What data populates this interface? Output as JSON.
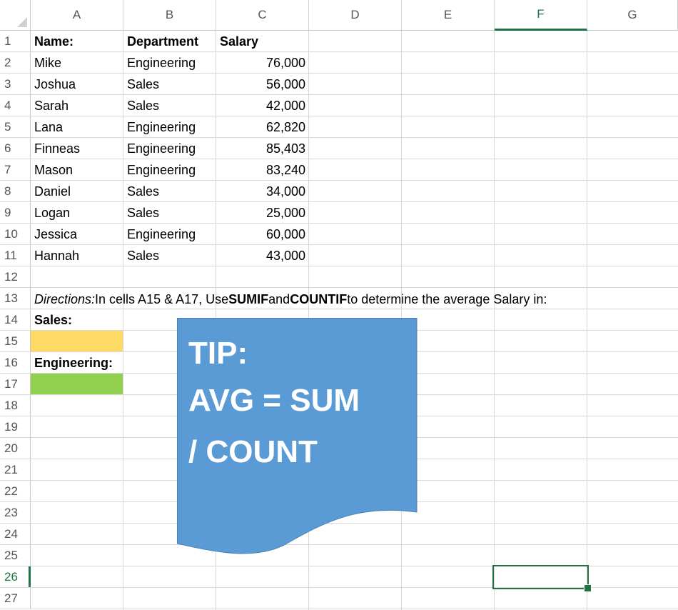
{
  "columns": [
    "A",
    "B",
    "C",
    "D",
    "E",
    "F",
    "G"
  ],
  "selected_column": "F",
  "row_numbers": [
    "1",
    "2",
    "3",
    "4",
    "5",
    "6",
    "7",
    "8",
    "9",
    "10",
    "11",
    "12",
    "13",
    "14",
    "15",
    "16",
    "17",
    "18",
    "19",
    "20",
    "21",
    "22",
    "23",
    "24",
    "25",
    "26",
    "27"
  ],
  "selected_row": "26",
  "headers": {
    "name": "Name:",
    "department": "Department",
    "salary": "Salary"
  },
  "employees": [
    {
      "name": "Mike",
      "department": "Engineering",
      "salary": "76,000"
    },
    {
      "name": "Joshua",
      "department": "Sales",
      "salary": "56,000"
    },
    {
      "name": "Sarah",
      "department": "Sales",
      "salary": "42,000"
    },
    {
      "name": "Lana",
      "department": "Engineering",
      "salary": "62,820"
    },
    {
      "name": "Finneas",
      "department": "Engineering",
      "salary": "85,403"
    },
    {
      "name": "Mason",
      "department": "Engineering",
      "salary": "83,240"
    },
    {
      "name": "Daniel",
      "department": "Sales",
      "salary": "34,000"
    },
    {
      "name": "Logan",
      "department": "Sales",
      "salary": "25,000"
    },
    {
      "name": "Jessica",
      "department": "Engineering",
      "salary": "60,000"
    },
    {
      "name": "Hannah",
      "department": "Sales",
      "salary": "43,000"
    }
  ],
  "directions": {
    "italic": "Directions:",
    "part1": " In cells A15 & A17, Use ",
    "sumif": "SUMIF",
    "part2": " and ",
    "countif": "COUNTIF",
    "part3": " to determine the average Salary in:"
  },
  "labels": {
    "sales": "Sales:",
    "engineering": "Engineering:"
  },
  "fills": {
    "sales_cell": "#ffd966",
    "engineering_cell": "#92d050",
    "tip_shape": "#5b9bd5",
    "selection": "#217346"
  },
  "tip": {
    "line1": "TIP:",
    "line2": "AVG = SUM",
    "line3": "/ COUNT"
  }
}
